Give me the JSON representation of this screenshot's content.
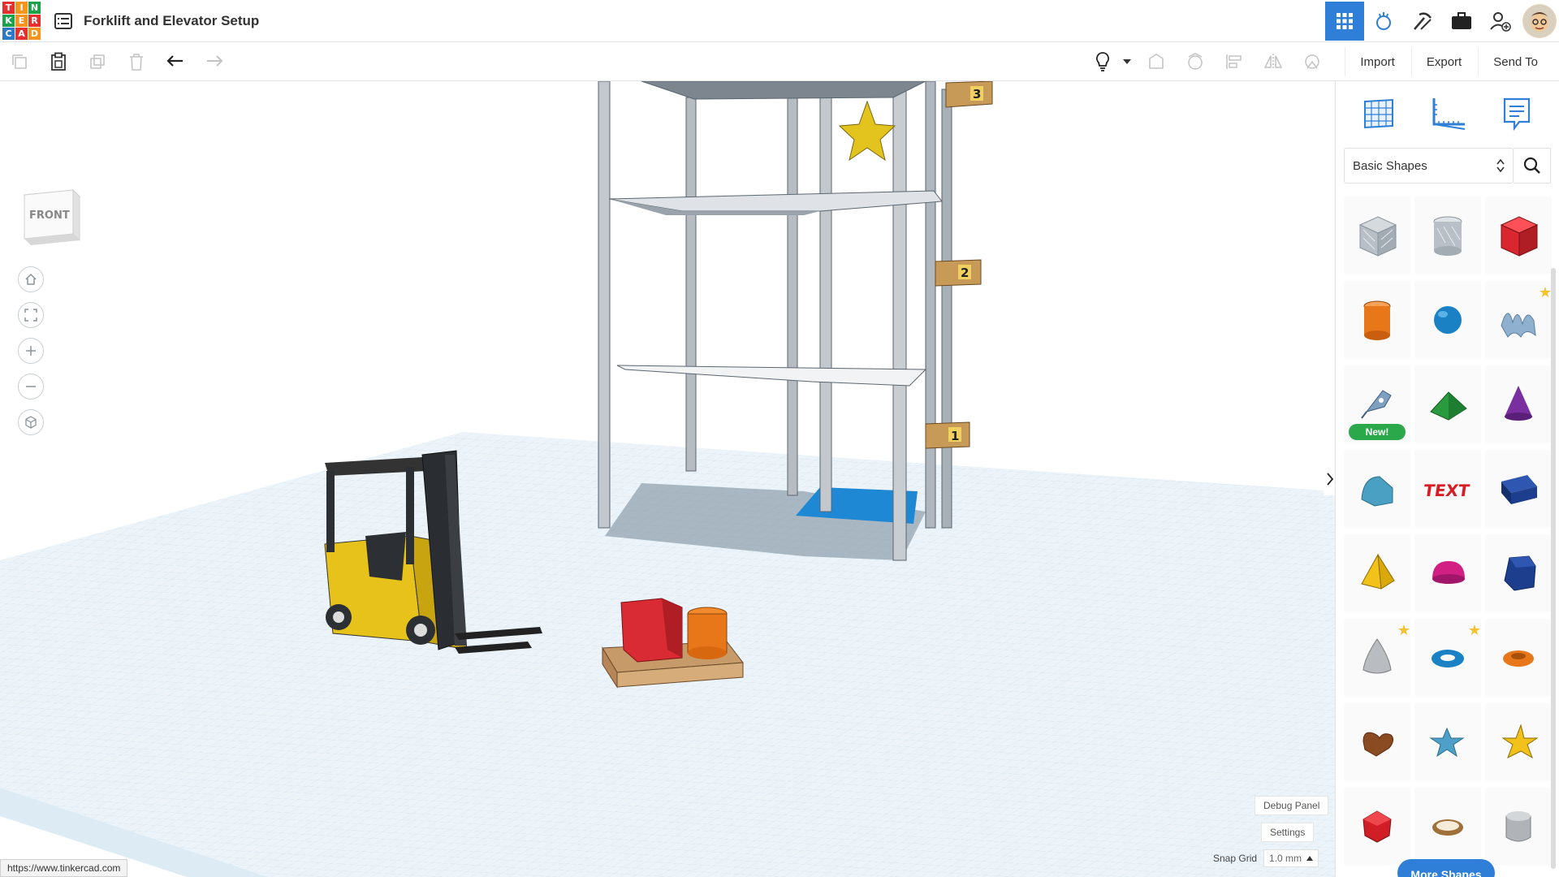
{
  "header": {
    "logo_letters": [
      "T",
      "I",
      "N",
      "K",
      "E",
      "R",
      "C",
      "A",
      "D"
    ],
    "logo_colors": [
      "#e6302f",
      "#f7941d",
      "#1aa34a",
      "#1aa34a",
      "#f7941d",
      "#e6302f",
      "#2c79c8",
      "#e6302f",
      "#f7941d"
    ],
    "title": "Forklift and Elevator Setup",
    "icons": [
      "grid-view-icon",
      "tinker-lab-icon",
      "hammer-pick-icon",
      "briefcase-icon",
      "add-user-icon"
    ]
  },
  "toolbar": {
    "import_label": "Import",
    "export_label": "Export",
    "send_to_label": "Send To"
  },
  "viewcube": {
    "face_label": "FRONT"
  },
  "panel": {
    "shape_category": "Basic Shapes",
    "new_badge": "New!",
    "more_shapes_label": "More Shapes",
    "shapes": [
      {
        "name": "box-hole",
        "color": "#a9b0b8"
      },
      {
        "name": "cylinder-hole",
        "color": "#a9b0b8"
      },
      {
        "name": "box",
        "color": "#d9262f"
      },
      {
        "name": "cylinder",
        "color": "#e8771a"
      },
      {
        "name": "sphere",
        "color": "#1a82c4"
      },
      {
        "name": "scribble",
        "color": "#8fb0cf"
      },
      {
        "name": "sketch",
        "color": "#7f9fc1"
      },
      {
        "name": "roof",
        "color": "#2a9a3f"
      },
      {
        "name": "cone",
        "color": "#7a2fa0"
      },
      {
        "name": "round-roof",
        "color": "#4aa0c2"
      },
      {
        "name": "text",
        "color": "#d61e26"
      },
      {
        "name": "shape-generator-box",
        "color": "#1d3e8c"
      },
      {
        "name": "pyramid",
        "color": "#f2c21a"
      },
      {
        "name": "half-sphere",
        "color": "#d11f84"
      },
      {
        "name": "polygon",
        "color": "#1d3e8c"
      },
      {
        "name": "paraboloid",
        "color": "#b9bcc0"
      },
      {
        "name": "torus",
        "color": "#1a82c4"
      },
      {
        "name": "tube",
        "color": "#e8771a"
      },
      {
        "name": "heart",
        "color": "#8a4a22"
      },
      {
        "name": "star",
        "color": "#4ea0c8"
      },
      {
        "name": "star-yellow",
        "color": "#f2c21a"
      },
      {
        "name": "icosahedron",
        "color": "#d11e26"
      },
      {
        "name": "ring",
        "color": "#a0703a"
      },
      {
        "name": "gray-cylinder",
        "color": "#b0b4b8"
      }
    ]
  },
  "workplane": {
    "shelf_labels": [
      "3",
      "2",
      "1"
    ]
  },
  "controls": {
    "debug_label": "Debug Panel",
    "settings_label": "Settings",
    "snap_label": "Snap Grid",
    "snap_value": "1.0 mm"
  },
  "status": {
    "url": "https://www.tinkercad.com"
  }
}
